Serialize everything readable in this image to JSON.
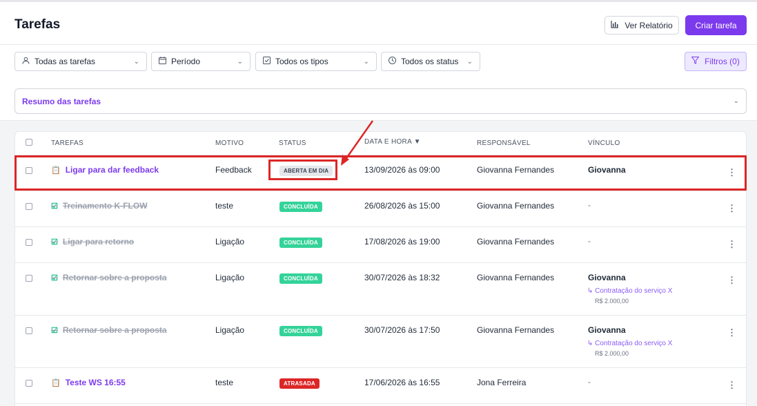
{
  "header": {
    "title": "Tarefas",
    "report_label": "Ver Relatório",
    "create_label": "Criar tarefa"
  },
  "filters": {
    "tasks": "Todas as tarefas",
    "period": "Período",
    "types": "Todos os tipos",
    "status": "Todos os status",
    "filters_button": "Filtros (0)"
  },
  "summary": {
    "label": "Resumo das tarefas"
  },
  "table": {
    "columns": {
      "tasks": "TAREFAS",
      "reason": "MOTIVO",
      "status": "STATUS",
      "datetime": "DATA E HORA ▼",
      "owner": "RESPONSÁVEL",
      "link": "VÍNCULO"
    },
    "rows": [
      {
        "title": "Ligar para dar feedback",
        "reason": "Feedback",
        "status": "ABERTA EM DIA",
        "datetime": "13/09/2026 às 09:00",
        "owner": "Giovanna Fernandes",
        "link": "Giovanna"
      },
      {
        "title": "Treinamento K-FLOW",
        "reason": "teste",
        "status": "CONCLUÍDA",
        "datetime": "26/08/2026 às 15:00",
        "owner": "Giovanna Fernandes",
        "link": "-"
      },
      {
        "title": "Ligar para retorno",
        "reason": "Ligação",
        "status": "CONCLUÍDA",
        "datetime": "17/08/2026 às 19:00",
        "owner": "Giovanna Fernandes",
        "link": "-"
      },
      {
        "title": "Retornar sobre a proposta",
        "reason": "Ligação",
        "status": "CONCLUÍDA",
        "datetime": "30/07/2026 às 18:32",
        "owner": "Giovanna Fernandes",
        "link": "Giovanna",
        "deal": "↳ Contratação do serviço X",
        "price": "R$ 2.000,00"
      },
      {
        "title": "Retornar sobre a proposta",
        "reason": "Ligação",
        "status": "CONCLUÍDA",
        "datetime": "30/07/2026 às 17:50",
        "owner": "Giovanna Fernandes",
        "link": "Giovanna",
        "deal": "↳ Contratação do serviço X",
        "price": "R$ 2.000,00"
      },
      {
        "title": "Teste WS 16:55",
        "reason": "teste",
        "status": "ATRASADA",
        "datetime": "17/06/2026 às 16:55",
        "owner": "Jona Ferreira",
        "link": "-"
      }
    ]
  },
  "colors": {
    "accent": "#7c3aed",
    "done": "#34d399",
    "late": "#dc2626",
    "annotation": "#dc2626"
  }
}
